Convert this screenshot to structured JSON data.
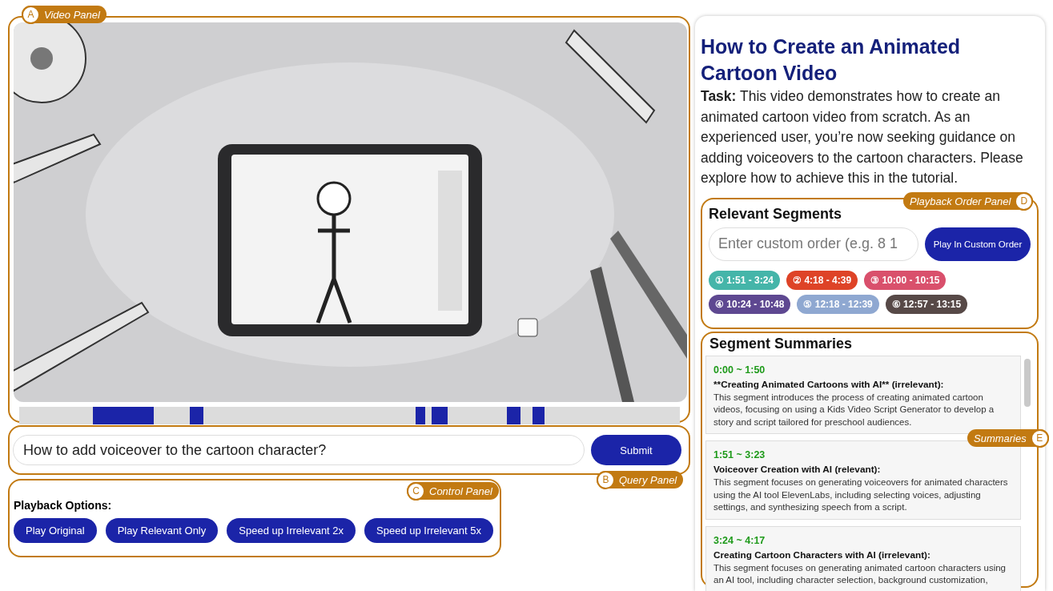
{
  "callouts": [
    {
      "letter": "A",
      "label": "Video Panel",
      "kind": "letter-first"
    },
    {
      "letter": "B",
      "label": "Query Panel",
      "kind": "letter-first"
    },
    {
      "letter": "C",
      "label": "Control Panel",
      "kind": "letter-first"
    },
    {
      "letter": "D",
      "label": "Playback Order Panel",
      "kind": "label-first"
    },
    {
      "letter": "E",
      "label": "Summaries",
      "kind": "label-first"
    }
  ],
  "query": {
    "value": "How to add voiceover to the cartoon character?",
    "button": "Submit"
  },
  "control_panel": {
    "heading": "Playback Options:",
    "buttons": [
      "Play Original",
      "Play Relevant Only",
      "Speed up Irrelevant 2x",
      "Speed up Irrelevant 5x"
    ]
  },
  "info": {
    "title": "How to Create an Animated Cartoon Video",
    "task": "**Task:** This video demonstrates how to create an animated cartoon video from scratch. As an experienced user, you’re now seeking guidance on adding voiceovers to the cartoon characters. Please explore how to achieve this in the tutorial."
  },
  "relevant_segments": {
    "heading": "Relevant Segments",
    "placeholder": "Enter custom order (e.g. 8 1",
    "button": "Play In Custom Order",
    "segments": [
      {
        "label": "① 1:51 - 3:24",
        "color": "#45b5a9"
      },
      {
        "label": "② 4:18 - 4:39",
        "color": "#de4327"
      },
      {
        "label": "③ 10:00 - 10:15",
        "color": "#d9506c"
      },
      {
        "label": "④ 10:24 - 10:48",
        "color": "#5e4891"
      },
      {
        "label": "⑤ 12:18 - 12:39",
        "color": "#8fa8d1"
      },
      {
        "label": "⑥ 12:57 - 13:15",
        "color": "#574947"
      }
    ]
  },
  "segment_summaries": {
    "heading": "Segment Summaries",
    "items": [
      {
        "time": "0:00 ~ 1:50",
        "title": "**Creating Animated Cartoons with AI** (irrelevant):",
        "text": "This segment introduces the process of creating animated cartoon videos, focusing on using a Kids Video Script Generator to develop a story and script tailored for preschool audiences."
      },
      {
        "time": "1:51 ~ 3:23",
        "title": "Voiceover Creation with AI (relevant):",
        "text": "This segment focuses on generating voiceovers for animated characters using the AI tool ElevenLabs, including selecting voices, adjusting settings, and synthesizing speech from a script."
      },
      {
        "time": "3:24 ~ 4:17",
        "title": "Creating Cartoon Characters with AI (irrelevant):",
        "text": "This segment focuses on generating animated cartoon characters using an AI tool, including character selection, background customization,"
      }
    ]
  }
}
